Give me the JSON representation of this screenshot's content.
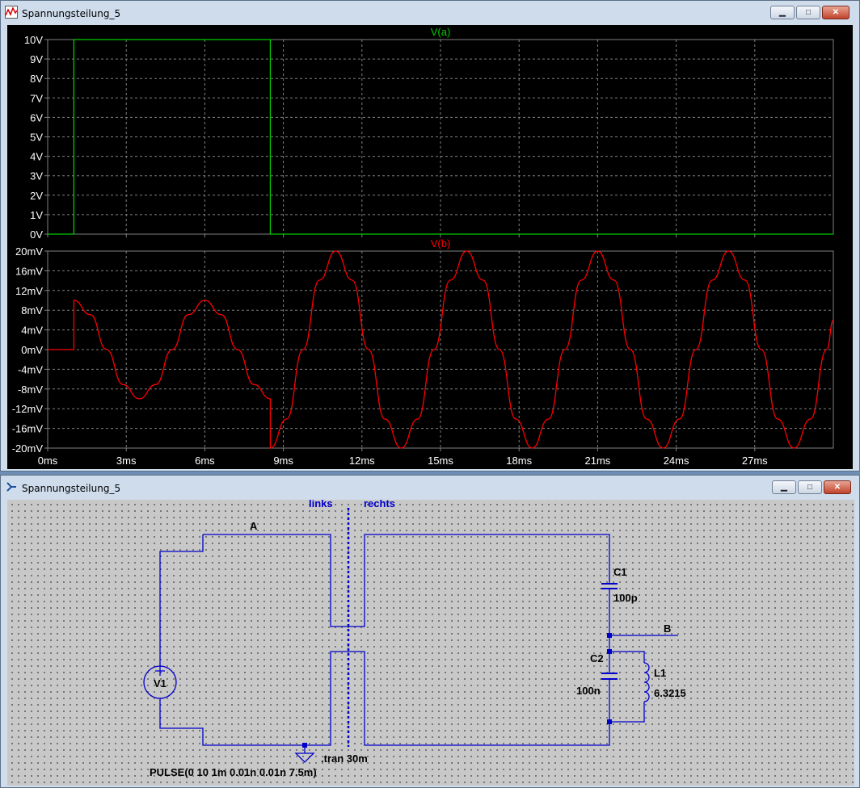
{
  "wave_window": {
    "title": "Spannungsteilung_5",
    "controls": {
      "minimize": "▁",
      "maximize": "□",
      "close": "✕"
    },
    "colors": {
      "background": "#000000",
      "grid": "#808080",
      "axis_text": "#ffffff",
      "trace_a": "#00cc00",
      "trace_b": "#ff0000"
    }
  },
  "schematic_window": {
    "title": "Spannungsteilung_5",
    "controls": {
      "minimize": "▁",
      "maximize": "□",
      "close": "✕"
    },
    "labels": {
      "left_side": "links",
      "right_side": "rechts",
      "net_a": "A",
      "net_b": "B",
      "c1_name": "C1",
      "c1_value": "100p",
      "c2_name": "C2",
      "c2_value": "100n",
      "l1_name": "L1",
      "l1_value": "6.3215",
      "v1_name": "V1",
      "tran": ".tran 30m",
      "pulse": "PULSE(0 10 1m 0.01n 0.01n 7.5m)"
    },
    "colors": {
      "wire": "#0000cc",
      "background": "#c8c8c8",
      "text": "#000000",
      "comment": "#0000cc"
    }
  },
  "chart_data": [
    {
      "type": "line",
      "title": "V(a)",
      "xlabel": "",
      "ylabel": "",
      "x_ticks": [
        "0ms",
        "3ms",
        "6ms",
        "9ms",
        "12ms",
        "15ms",
        "18ms",
        "21ms",
        "24ms",
        "27ms"
      ],
      "y_ticks": [
        "10V",
        "9V",
        "8V",
        "7V",
        "6V",
        "5V",
        "4V",
        "3V",
        "2V",
        "1V",
        "0V"
      ],
      "xlim": [
        0,
        30
      ],
      "ylim": [
        0,
        10
      ],
      "grid": true,
      "series": [
        {
          "name": "V(a)",
          "x": [
            0,
            1,
            1,
            8.5,
            8.5,
            30
          ],
          "y": [
            0,
            0,
            10,
            10,
            0,
            0
          ]
        }
      ]
    },
    {
      "type": "line",
      "title": "V(b)",
      "xlabel": "",
      "ylabel": "",
      "x_ticks": [
        "0ms",
        "3ms",
        "6ms",
        "9ms",
        "12ms",
        "15ms",
        "18ms",
        "21ms",
        "24ms",
        "27ms"
      ],
      "y_ticks": [
        "20mV",
        "16mV",
        "12mV",
        "8mV",
        "4mV",
        "0mV",
        "-4mV",
        "-8mV",
        "-12mV",
        "-16mV",
        "-20mV"
      ],
      "xlim": [
        0,
        30
      ],
      "ylim": [
        -20,
        20
      ],
      "grid": true,
      "series": [
        {
          "name": "V(b)",
          "x": [
            0,
            1,
            1,
            1.625,
            2.25,
            2.875,
            3.5,
            4.125,
            4.75,
            5.375,
            6,
            6.625,
            7.25,
            7.875,
            8.5,
            8.5,
            9.125,
            9.75,
            10.375,
            11,
            11.625,
            12.25,
            12.875,
            13.5,
            14.125,
            14.75,
            15.375,
            16,
            16.625,
            17.25,
            17.875,
            18.5,
            19.125,
            19.75,
            20.375,
            21,
            21.625,
            22.25,
            22.875,
            23.5,
            24.125,
            24.75,
            25.375,
            26,
            26.625,
            27.25,
            27.875,
            28.5,
            29.125,
            29.75,
            30
          ],
          "y": [
            0,
            0,
            10,
            7.1,
            0,
            -7.1,
            -10,
            -7.1,
            0,
            7.1,
            10,
            7.1,
            0,
            -7.1,
            -10,
            -20,
            -14.1,
            0,
            14.1,
            20,
            14.1,
            0,
            -14.1,
            -20,
            -14.1,
            0,
            14.1,
            20,
            14.1,
            0,
            -14.1,
            -20,
            -14.1,
            0,
            14.1,
            20,
            14.1,
            0,
            -14.1,
            -20,
            -14.1,
            0,
            14.1,
            20,
            14.1,
            0,
            -14.1,
            -20,
            -14.1,
            0,
            6
          ]
        }
      ]
    }
  ]
}
